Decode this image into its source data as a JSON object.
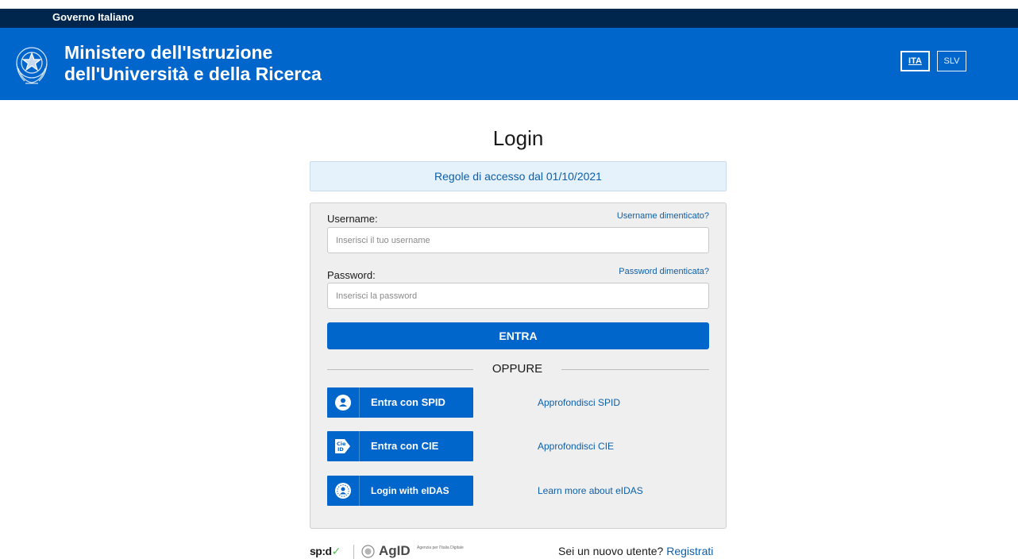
{
  "gov_bar": {
    "label": "Governo Italiano"
  },
  "header": {
    "title_line1": "Ministero dell'Istruzione",
    "title_line2": "dell'Università e della Ricerca",
    "languages": [
      {
        "code": "ITA",
        "active": true
      },
      {
        "code": "SLV",
        "active": false
      }
    ]
  },
  "main": {
    "title": "Login",
    "rules_link": "Regole di accesso dal 01/10/2021",
    "username": {
      "label": "Username:",
      "placeholder": "Inserisci il tuo username",
      "value": "",
      "forgot": "Username dimenticato?"
    },
    "password": {
      "label": "Password:",
      "placeholder": "Inserisci la password",
      "value": "",
      "forgot": "Password dimenticata?"
    },
    "submit_label": "ENTRA",
    "or_label": "OPPURE",
    "identity_providers": [
      {
        "icon": "spid-user-icon",
        "label": "Entra con SPID",
        "learn_more": "Approfondisci SPID"
      },
      {
        "icon": "cie-id-card-icon",
        "label": "Entra con CIE",
        "learn_more": "Approfondisci CIE"
      },
      {
        "icon": "eidas-user-icon",
        "label": "Login with eIDAS",
        "learn_more": "Learn more about eIDAS"
      }
    ]
  },
  "footer": {
    "spid_logo": "sp:d",
    "agid_logo": "AgID",
    "agid_subtitle": "Agenzia per l'Italia Digitale",
    "new_user_text": "Sei un nuovo utente?",
    "register_link": "Registrati"
  },
  "colors": {
    "gov_bar": "#00264d",
    "header_blue": "#0066cc",
    "link_blue": "#0d5fa8",
    "panel_gray": "#efefef",
    "rules_bg": "#e5f1fb"
  }
}
